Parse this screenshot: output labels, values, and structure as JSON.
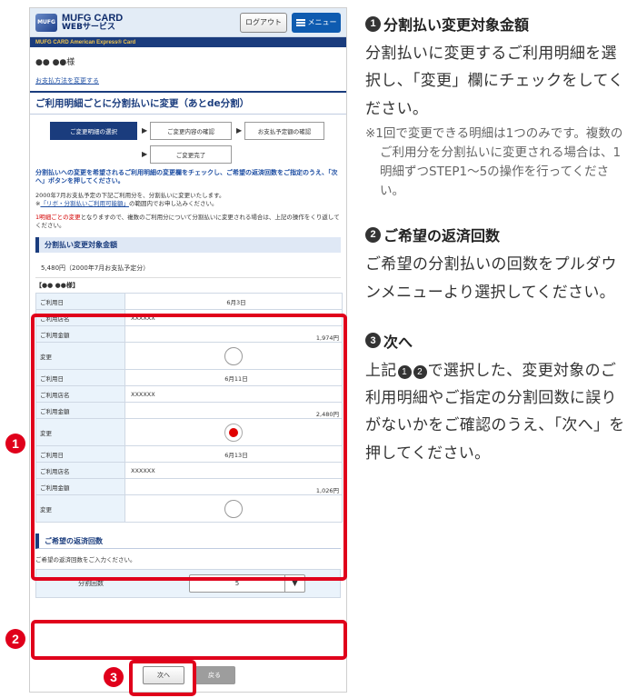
{
  "app": {
    "brand_line1": "MUFG CARD",
    "brand_line2": "WEBサービス",
    "brand_strip": "MUFG CARD American Express® Card",
    "logo_mark": "MUFG",
    "logout_label": "ログアウト",
    "menu_label": "メニュー"
  },
  "user_line": "●● ●●様",
  "breadcrumb": "お支払方法を変更する",
  "page_title": "ご利用明細ごとに分割払いに変更（あとde分割）",
  "steps": [
    {
      "label": "ご変更明細の選択",
      "active": true
    },
    {
      "label": "ご変更内容の確認",
      "active": false
    },
    {
      "label": "お支払予定額の確認",
      "active": false
    },
    {
      "label": "ご変更完了",
      "active": false
    }
  ],
  "notice": "分割払いへの変更を希望されるご利用明細の変更欄をチェックし、ご希望の返済回数をご指定のうえ、「次へ」ボタンを押してください。",
  "para1_text": "2000年7月お支払予定の下記ご利用分を、分割払いに変更いたします。",
  "para1_note_prefix": "※",
  "para1_link": "「リボ・分割払いご利用可能額」",
  "para1_note_suffix": "の範囲内でお申し込みください。",
  "para2_red": "1明細ごとの変更",
  "para2_text": "となりますので、複数のご利用分について分割払いに変更される場合は、上記の操作をくり返してください。",
  "section1_title": "分割払い変更対象金額",
  "amount_line": "5,480円（2000年7月お支払予定分）",
  "user_sub": "【●● ●●様】",
  "labels": {
    "date": "ご利用日",
    "store": "ご利用店名",
    "amount": "ご利用金額",
    "change": "変更"
  },
  "details": [
    {
      "date": "6月3日",
      "store": "XXXXXX",
      "amount": "1,974円",
      "selected": false
    },
    {
      "date": "6月11日",
      "store": "XXXXXX",
      "amount": "2,480円",
      "selected": true
    },
    {
      "date": "6月13日",
      "store": "XXXXXX",
      "amount": "1,026円",
      "selected": false
    }
  ],
  "section2_title": "ご希望の返済回数",
  "select_help": "ご希望の返済回数をご入力ください。",
  "select_label": "分割回数",
  "select_value": "5",
  "next_label": "次へ",
  "back_label": "戻る",
  "badges": [
    "1",
    "2",
    "3"
  ],
  "explain": {
    "s1_num": "1",
    "s1_title": "分割払い変更対象金額",
    "s1_body": "分割払いに変更するご利用明細を選択し、「変更」欄にチェックをしてください。",
    "s1_note": "※1回で変更できる明細は1つのみです。複数のご利用分を分割払いに変更される場合は、1明細ずつSTEP1〜5の操作を行ってください。",
    "s2_num": "2",
    "s2_title": "ご希望の返済回数",
    "s2_body": "ご希望の分割払いの回数をプルダウンメニューより選択してください。",
    "s3_num": "3",
    "s3_title": "次へ",
    "s3_body_prefix": "上記",
    "s3_body_num1": "1",
    "s3_body_num2": "2",
    "s3_body_suffix": "で選択した、変更対象のご利用明細やご指定の分割回数に誤りがないかをご確認のうえ、「次へ」を押してください。"
  },
  "colors": {
    "accent_red": "#e0001b",
    "navy": "#1a3c7d",
    "link_blue": "#1f4fa3",
    "radio_on": "#e00000"
  }
}
